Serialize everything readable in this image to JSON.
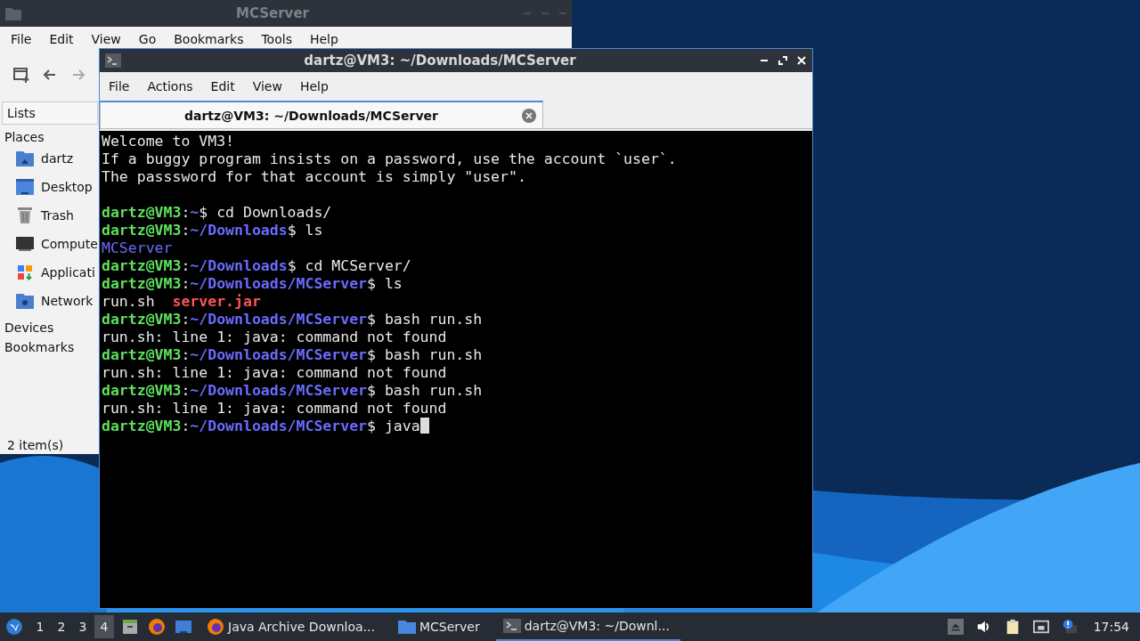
{
  "file_manager": {
    "title": "MCServer",
    "menu": [
      "File",
      "Edit",
      "View",
      "Go",
      "Bookmarks",
      "Tools",
      "Help"
    ],
    "side_pane_mode": "Lists",
    "sections": [
      {
        "label": "Places",
        "items": [
          {
            "label": "dartz",
            "kind": "home"
          },
          {
            "label": "Desktop",
            "kind": "desktop"
          },
          {
            "label": "Trash",
            "kind": "trash"
          },
          {
            "label": "Compute",
            "kind": "computer"
          },
          {
            "label": "Applicati",
            "kind": "apps"
          },
          {
            "label": "Network",
            "kind": "network"
          }
        ]
      },
      {
        "label": "Devices"
      },
      {
        "label": "Bookmarks"
      }
    ],
    "status": "2 item(s)"
  },
  "terminal": {
    "title": "dartz@VM3: ~/Downloads/MCServer",
    "menu": [
      "File",
      "Actions",
      "Edit",
      "View",
      "Help"
    ],
    "tabs": [
      {
        "label": "dartz@VM3: ~/Downloads/MCServer",
        "selected": true
      }
    ],
    "lines": [
      [
        {
          "kind": "plain",
          "text": "Welcome to VM3!"
        }
      ],
      [
        {
          "kind": "plain",
          "text": "If a buggy program insists on a password, use the account `user`."
        }
      ],
      [
        {
          "kind": "plain",
          "text": "The passsword for that account is simply \"user\"."
        }
      ],
      [
        {
          "kind": "blank"
        }
      ],
      [
        {
          "kind": "user",
          "text": "dartz@VM3"
        },
        {
          "kind": "plain",
          "text": ":"
        },
        {
          "kind": "path",
          "text": "~"
        },
        {
          "kind": "plain",
          "text": "$ cd Downloads/"
        }
      ],
      [
        {
          "kind": "user",
          "text": "dartz@VM3"
        },
        {
          "kind": "plain",
          "text": ":"
        },
        {
          "kind": "path",
          "text": "~/Downloads"
        },
        {
          "kind": "plain",
          "text": "$ ls"
        }
      ],
      [
        {
          "kind": "dir",
          "text": "MCServer"
        }
      ],
      [
        {
          "kind": "user",
          "text": "dartz@VM3"
        },
        {
          "kind": "plain",
          "text": ":"
        },
        {
          "kind": "path",
          "text": "~/Downloads"
        },
        {
          "kind": "plain",
          "text": "$ cd MCServer/"
        }
      ],
      [
        {
          "kind": "user",
          "text": "dartz@VM3"
        },
        {
          "kind": "plain",
          "text": ":"
        },
        {
          "kind": "path",
          "text": "~/Downloads/MCServer"
        },
        {
          "kind": "plain",
          "text": "$ ls"
        }
      ],
      [
        {
          "kind": "plain",
          "text": "run.sh  "
        },
        {
          "kind": "archive",
          "text": "server.jar"
        }
      ],
      [
        {
          "kind": "user",
          "text": "dartz@VM3"
        },
        {
          "kind": "plain",
          "text": ":"
        },
        {
          "kind": "path",
          "text": "~/Downloads/MCServer"
        },
        {
          "kind": "plain",
          "text": "$ bash run.sh"
        }
      ],
      [
        {
          "kind": "plain",
          "text": "run.sh: line 1: java: command not found"
        }
      ],
      [
        {
          "kind": "user",
          "text": "dartz@VM3"
        },
        {
          "kind": "plain",
          "text": ":"
        },
        {
          "kind": "path",
          "text": "~/Downloads/MCServer"
        },
        {
          "kind": "plain",
          "text": "$ bash run.sh"
        }
      ],
      [
        {
          "kind": "plain",
          "text": "run.sh: line 1: java: command not found"
        }
      ],
      [
        {
          "kind": "user",
          "text": "dartz@VM3"
        },
        {
          "kind": "plain",
          "text": ":"
        },
        {
          "kind": "path",
          "text": "~/Downloads/MCServer"
        },
        {
          "kind": "plain",
          "text": "$ bash run.sh"
        }
      ],
      [
        {
          "kind": "plain",
          "text": "run.sh: line 1: java: command not found"
        }
      ],
      [
        {
          "kind": "user",
          "text": "dartz@VM3"
        },
        {
          "kind": "plain",
          "text": ":"
        },
        {
          "kind": "path",
          "text": "~/Downloads/MCServer"
        },
        {
          "kind": "plain",
          "text": "$ java"
        },
        {
          "kind": "cursor"
        }
      ]
    ]
  },
  "taskbar": {
    "workspaces": [
      {
        "label": "1",
        "selected": false
      },
      {
        "label": "2",
        "selected": false
      },
      {
        "label": "3",
        "selected": false
      },
      {
        "label": "4",
        "selected": true
      }
    ],
    "tasks": [
      {
        "label": "Java Archive Downloa...",
        "kind": "browser",
        "selected": false
      },
      {
        "label": "MCServer",
        "kind": "folder",
        "selected": false
      },
      {
        "label": "dartz@VM3: ~/Downl...",
        "kind": "terminal",
        "selected": true
      }
    ],
    "clock": "17:54"
  }
}
